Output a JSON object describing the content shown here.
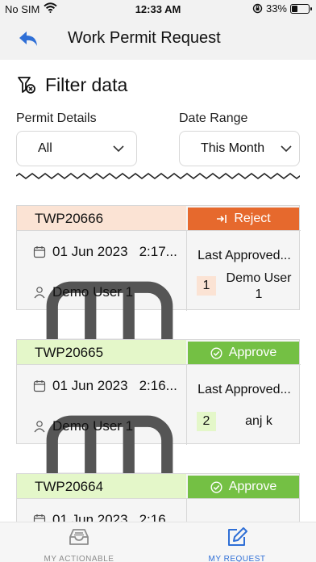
{
  "status_bar": {
    "carrier": "No SIM",
    "time": "12:33 AM",
    "battery": "33%",
    "battery_level": 0.33
  },
  "header": {
    "title": "Work Permit Request",
    "back_icon": "back-arrow-icon"
  },
  "filter": {
    "title": "Filter data",
    "permit_label": "Permit Details",
    "permit_value": "All",
    "date_label": "Date Range",
    "date_value": "This Month"
  },
  "permits": [
    {
      "id": "TWP20666",
      "header_color": "#fbe3d4",
      "status": "Reject",
      "status_color": "#e6692d",
      "date": "01 Jun 2023",
      "time": "2:17...",
      "user": "Demo User 1",
      "last_approved": "Last Approved...",
      "level": "1",
      "level_color": "#fbe3d4",
      "approver": "Demo User 1"
    },
    {
      "id": "TWP20665",
      "header_color": "#e4f7c9",
      "status": "Approve",
      "status_color": "#74c044",
      "date": "01 Jun 2023",
      "time": "2:16...",
      "user": "Demo User 1",
      "last_approved": "Last Approved...",
      "level": "2",
      "level_color": "#e4f7c9",
      "approver": "anj k"
    },
    {
      "id": "TWP20664",
      "header_color": "#e4f7c9",
      "status": "Approve",
      "status_color": "#74c044",
      "date": "01 Jun 2023",
      "time": "2:16"
    }
  ],
  "tabs": [
    {
      "label": "MY ACTIONABLE",
      "color": "#8c8c8c"
    },
    {
      "label": "MY REQUEST",
      "color": "#2f6fd6"
    }
  ],
  "colors": {
    "accent": "#2f6fd6",
    "bar_bg": "#f2f2f2"
  }
}
